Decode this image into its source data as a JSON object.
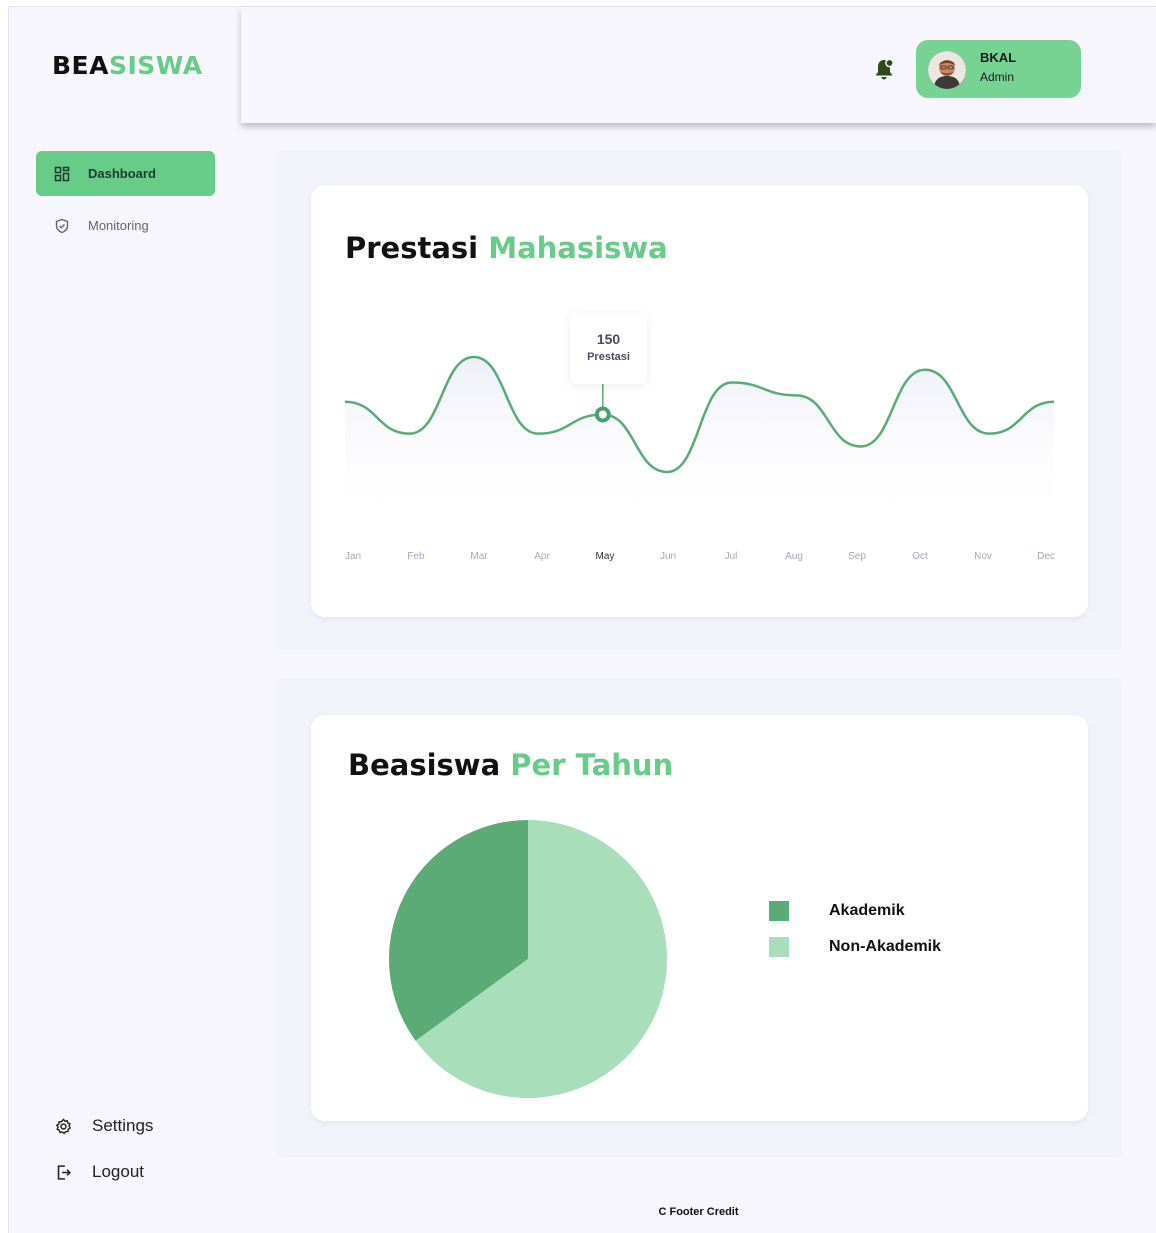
{
  "app": {
    "logo_part1": "BEA",
    "logo_part2": "SISWA"
  },
  "sidebar": {
    "items": [
      {
        "label": "Dashboard",
        "icon": "dashboard-icon",
        "active": true
      },
      {
        "label": "Monitoring",
        "icon": "shield-icon",
        "active": false
      }
    ],
    "bottom": [
      {
        "label": "Settings",
        "icon": "gear-icon"
      },
      {
        "label": "Logout",
        "icon": "logout-icon"
      }
    ]
  },
  "header": {
    "user_name": "BKAL",
    "user_role": "Admin"
  },
  "prestasi": {
    "title_part1": "Prestasi",
    "title_part2": "Mahasiswa",
    "tooltip_value": "150",
    "tooltip_label": "Prestasi",
    "active_month": "May"
  },
  "beasiswa": {
    "title_part1": "Beasiswa",
    "title_part2": "Per Tahun",
    "legend": [
      {
        "label": "Akademik",
        "color": "#5aab76"
      },
      {
        "label": "Non-Akademik",
        "color": "#a8dfba"
      }
    ]
  },
  "footer": {
    "text": "C Footer Credit"
  },
  "colors": {
    "accent": "#66cc88",
    "line": "#5aab76",
    "background": "#f6f6fc"
  },
  "chart_data": [
    {
      "type": "line",
      "title": "Prestasi Mahasiswa",
      "x": [
        "Jan",
        "Feb",
        "Mar",
        "Apr",
        "May",
        "Jun",
        "Jul",
        "Aug",
        "Sep",
        "Oct",
        "Nov",
        "Dec"
      ],
      "series": [
        {
          "values": [
            170,
            120,
            240,
            120,
            150,
            60,
            200,
            180,
            100,
            220,
            120,
            170
          ]
        }
      ],
      "highlight": {
        "x": "May",
        "value": 150,
        "label": "Prestasi"
      },
      "grid": false
    },
    {
      "type": "pie",
      "title": "Beasiswa Per Tahun",
      "categories": [
        "Akademik",
        "Non-Akademik"
      ],
      "values": [
        35,
        65
      ],
      "legend_position": "right"
    }
  ]
}
